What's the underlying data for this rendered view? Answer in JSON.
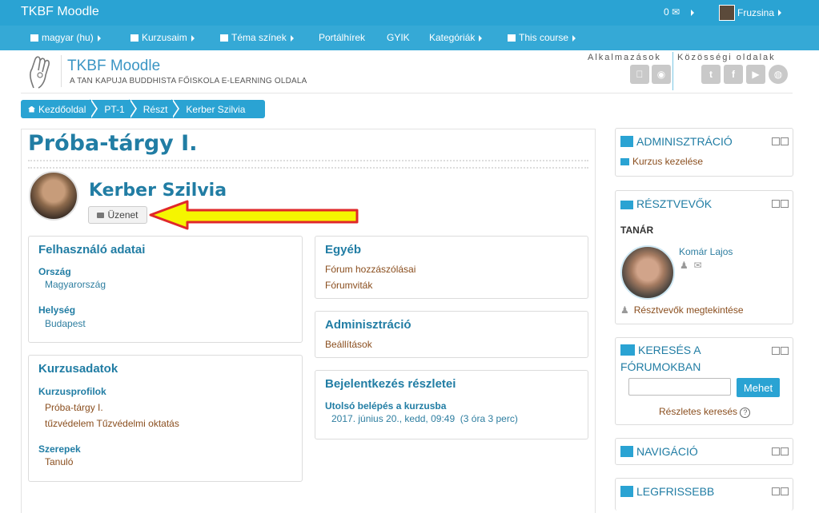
{
  "topbar": {
    "brand": "TKBF Moodle",
    "message_count": "0",
    "user_name": "Fruzsina"
  },
  "nav": {
    "language": "magyar (hu)",
    "courses": "Kurzusaim",
    "theme_colors": "Téma színek",
    "portal_news": "Portálhírek",
    "faq": "GYIK",
    "categories": "Kategóriák",
    "this_course": "This course"
  },
  "header": {
    "title": "TKBF Moodle",
    "subtitle": "A TAN KAPUJA BUDDHISTA FŐISKOLA E-LEARNING OLDALA",
    "apps_label": "Alkalmazások",
    "social_label": "Közösségi oldalak"
  },
  "breadcrumb": [
    "Kezdőoldal",
    "PT-1",
    "Részt",
    "Kerber Szilvia"
  ],
  "page": {
    "title": "Próba-tárgy I.",
    "user_name": "Kerber Szilvia",
    "message_button": "Üzenet"
  },
  "user_details": {
    "title": "Felhasználó adatai",
    "country_label": "Ország",
    "country": "Magyarország",
    "city_label": "Helység",
    "city": "Budapest"
  },
  "course_details": {
    "title": "Kurzusadatok",
    "profiles_label": "Kurzusprofilok",
    "profiles": [
      "Próba-tárgy I.",
      "tűzvédelem Tűzvédelmi oktatás"
    ],
    "roles_label": "Szerepek",
    "role": "Tanuló"
  },
  "misc": {
    "title": "Egyéb",
    "links": [
      "Fórum hozzászólásai",
      "Fórumviták"
    ]
  },
  "admin_card": {
    "title": "Adminisztráció",
    "link": "Beállítások"
  },
  "login_details": {
    "title": "Bejelentkezés részletei",
    "last_access_label": "Utolsó belépés a kurzusba",
    "last_access": "2017. június 20., kedd, 09:49  (3 óra 3 perc)"
  },
  "sidebar": {
    "admin": {
      "title": "ADMINISZTRÁCIÓ",
      "link": "Kurzus kezelése"
    },
    "participants": {
      "title": "RÉSZTVEVŐK",
      "role": "TANÁR",
      "teacher": "Komár Lajos",
      "view_link": "Résztvevők megtekintése"
    },
    "forum_search": {
      "title_line1": "KERESÉS A",
      "title_line2": "FÓRUMOKBAN",
      "button": "Mehet",
      "advanced": "Részletes keresés"
    },
    "navigation": {
      "title": "NAVIGÁCIÓ"
    },
    "latest": {
      "title": "LEGFRISSEBB"
    }
  },
  "colors": {
    "accent": "#2aa3d3",
    "heading": "#217da4",
    "link": "#8a4e1e",
    "annotation_arrow": "#f5f500",
    "annotation_outline": "#e0282a"
  }
}
